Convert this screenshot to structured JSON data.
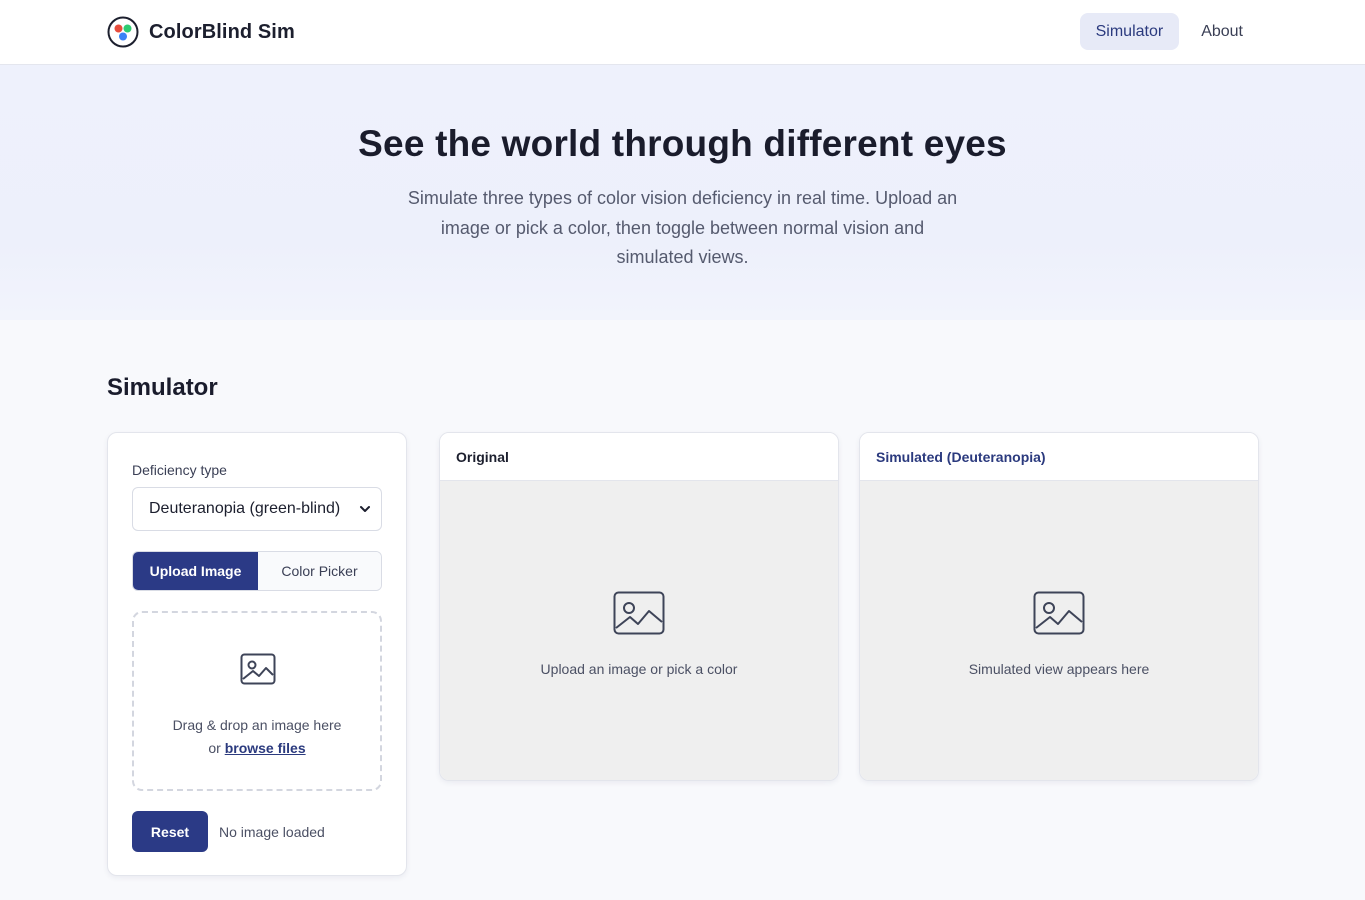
{
  "header": {
    "brand": "ColorBlind Sim",
    "nav": [
      {
        "label": "Simulator",
        "active": true
      },
      {
        "label": "About",
        "active": false
      }
    ]
  },
  "hero": {
    "title": "See the world through different eyes",
    "subtitle": "Simulate three types of color vision deficiency in real time. Upload an image or pick a color, then toggle between normal vision and simulated views."
  },
  "simulator": {
    "section_title": "Simulator",
    "controls": {
      "deficiency_label": "Deficiency type",
      "deficiency_selected": "Deuteranopia (green-blind)",
      "modes": [
        {
          "label": "Upload Image",
          "active": true
        },
        {
          "label": "Color Picker",
          "active": false
        }
      ],
      "dropzone": {
        "line1": "Drag & drop an image here",
        "prefix": "or ",
        "link": "browse files",
        "icon": "image-icon"
      },
      "reset_label": "Reset",
      "status": "No image loaded"
    },
    "panels": {
      "original": {
        "title": "Original",
        "placeholder": "Upload an image or pick a color",
        "icon": "image-icon"
      },
      "simulated": {
        "title": "Simulated (Deuteranopia)",
        "placeholder": "Simulated view appears here",
        "icon": "image-icon"
      }
    }
  },
  "colors": {
    "accent": "#2b3a86",
    "logo_red": "#e74c3c",
    "logo_green": "#2ecc71",
    "logo_blue": "#3b82f6"
  }
}
